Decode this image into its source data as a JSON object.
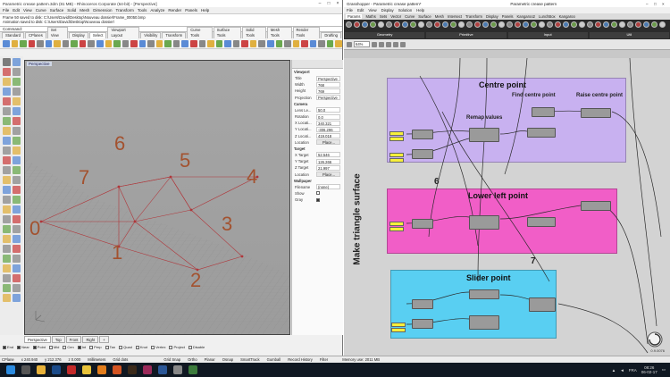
{
  "rhino": {
    "title": "Parametric crease pattern.3dm (81 MB) - Rhinoceros Corporate (64-bit) - [Perspective]",
    "menu": [
      "File",
      "Edit",
      "View",
      "Curve",
      "Surface",
      "Solid",
      "Mesh",
      "Dimension",
      "Transform",
      "Tools",
      "Analyze",
      "Render",
      "Panels",
      "Help"
    ],
    "cmd_history": [
      "Frame 50 saved to disk: C:\\Users\\David\\Desktop\\Nouveau dossier\\Frame_00050.bmp",
      "Animation saved to disk: C:\\Users\\David\\Desktop\\Nouveau dossier\\"
    ],
    "command_label": "Command:",
    "tabs": [
      "Standard",
      "CPlanes",
      "Set View",
      "Display",
      "Select",
      "Viewport Layout",
      "Visibility",
      "Transform",
      "Curve Tools",
      "Surface Tools",
      "Solid Tools",
      "Mesh Tools",
      "Render Tools",
      "Drafting"
    ],
    "active_tab": "Select",
    "viewport_title": "Perspective",
    "point_labels": [
      "0",
      "1",
      "2",
      "3",
      "4",
      "5",
      "6",
      "7"
    ],
    "view_tabs": [
      "Perspective",
      "Top",
      "Front",
      "Right",
      "+"
    ],
    "osnaps": [
      {
        "label": "End",
        "on": true
      },
      {
        "label": "Near",
        "on": true
      },
      {
        "label": "Point",
        "on": true
      },
      {
        "label": "Mid",
        "on": false
      },
      {
        "label": "Cen",
        "on": false
      },
      {
        "label": "Int",
        "on": true
      },
      {
        "label": "Perp",
        "on": false
      },
      {
        "label": "Tan",
        "on": false
      },
      {
        "label": "Quad",
        "on": false
      },
      {
        "label": "Knot",
        "on": false
      },
      {
        "label": "Vertex",
        "on": false
      },
      {
        "label": "Project",
        "on": false
      },
      {
        "label": "Disable",
        "on": false
      }
    ],
    "properties": {
      "viewport_section": "Viewport",
      "title_label": "Title",
      "title_value": "Perspective",
      "width_label": "Width",
      "width_value": "768",
      "height_label": "Height",
      "height_value": "769",
      "projection_label": "Projection",
      "projection_value": "Perspective",
      "camera_section": "Camera",
      "lens_label": "Lens Le...",
      "lens_value": "50.0",
      "rotation_label": "Rotation",
      "rotation_value": "0.0",
      "xloc_label": "X Locati...",
      "xloc_value": "340.321",
      "yloc_label": "Y Locati...",
      "yloc_value": "-306.296",
      "zloc_label": "Z Locati...",
      "zloc_value": "419.018",
      "location_label": "Location",
      "location_button": "Place...",
      "target_section": "Target",
      "xt_label": "X Target",
      "xt_value": "52.546",
      "yt_label": "Y Target",
      "yt_value": "126.266",
      "zt_label": "Z Target",
      "zt_value": "21.997",
      "tlocation_label": "Location",
      "tlocation_button": "Place...",
      "wallpaper_section": "Wallpaper",
      "filename_label": "Filename",
      "filename_value": "(none)",
      "show_label": "Show",
      "gray_label": "Gray"
    },
    "status": {
      "cplane": "CPlane",
      "x": "x 240.940",
      "y": "y 212.376",
      "z": "z 0.000",
      "units": "Millimeters",
      "layer": "Grid dots",
      "toggles": [
        "Grid Snap",
        "Ortho",
        "Planar",
        "Osnap",
        "SmartTrack",
        "Gumball",
        "Record History",
        "Filter"
      ],
      "mem": "Memory use: 2011 MB"
    }
  },
  "gh": {
    "title": "Grasshopper - Parametric crease pattern*",
    "title_right": "Parametric crease pattern",
    "menu": [
      "File",
      "Edit",
      "View",
      "Display",
      "Solution",
      "Help"
    ],
    "tabs": [
      "Params",
      "Maths",
      "Sets",
      "Vector",
      "Curve",
      "Surface",
      "Mesh",
      "Intersect",
      "Transform",
      "Display",
      "Panels",
      "Kangaroo2",
      "LunchBox",
      "Kangaroo"
    ],
    "active_tab": "Params",
    "ribbon_groups": [
      "Geometry",
      "Primitive",
      "Input",
      "Util"
    ],
    "zoom": "64%",
    "groups": [
      {
        "title": "Centre point",
        "color": "#c8b1f0"
      },
      {
        "title": "Lower left point",
        "color": "#f15ec7"
      },
      {
        "title": "Slider point",
        "color": "#59cff2"
      }
    ],
    "annotations": [
      "Find centre point",
      "Raise centre point",
      "Remap values",
      "6",
      "7",
      "Make triangle surface"
    ],
    "version": "0.9.0076"
  },
  "taskbar": {
    "lang": "FRA",
    "time": "08:26",
    "date": "06-02-17"
  }
}
